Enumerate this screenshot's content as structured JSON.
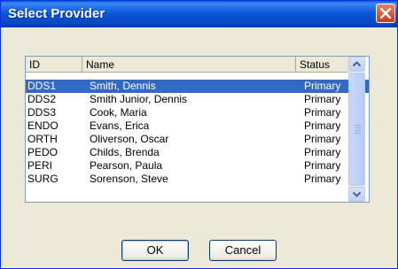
{
  "window": {
    "title": "Select Provider"
  },
  "list": {
    "columns": [
      "ID",
      "Name",
      "Status"
    ],
    "rows": [
      {
        "id": "DDS1",
        "name": "Smith, Dennis",
        "status": "Primary"
      },
      {
        "id": "DDS2",
        "name": "Smith Junior, Dennis",
        "status": "Primary"
      },
      {
        "id": "DDS3",
        "name": "Cook, Maria",
        "status": "Primary"
      },
      {
        "id": "ENDO",
        "name": "Evans, Erica",
        "status": "Primary"
      },
      {
        "id": "ORTH",
        "name": "Oliverson, Oscar",
        "status": "Primary"
      },
      {
        "id": "PEDO",
        "name": "Childs, Brenda",
        "status": "Primary"
      },
      {
        "id": "PERI",
        "name": "Pearson, Paula",
        "status": "Primary"
      },
      {
        "id": "SURG",
        "name": "Sorenson, Steve",
        "status": "Primary"
      }
    ],
    "selected_row": "DDS1"
  },
  "buttons": {
    "ok": "OK",
    "cancel": "Cancel"
  },
  "icons": {
    "close": "close-icon",
    "scroll_up": "arrow-up-icon",
    "scroll_down": "arrow-down-icon"
  },
  "colors": {
    "title_bar": "#0b58d9",
    "selection": "#316ac5",
    "dialog_bg": "#ece9d8",
    "close_button": "#c83b1c"
  }
}
